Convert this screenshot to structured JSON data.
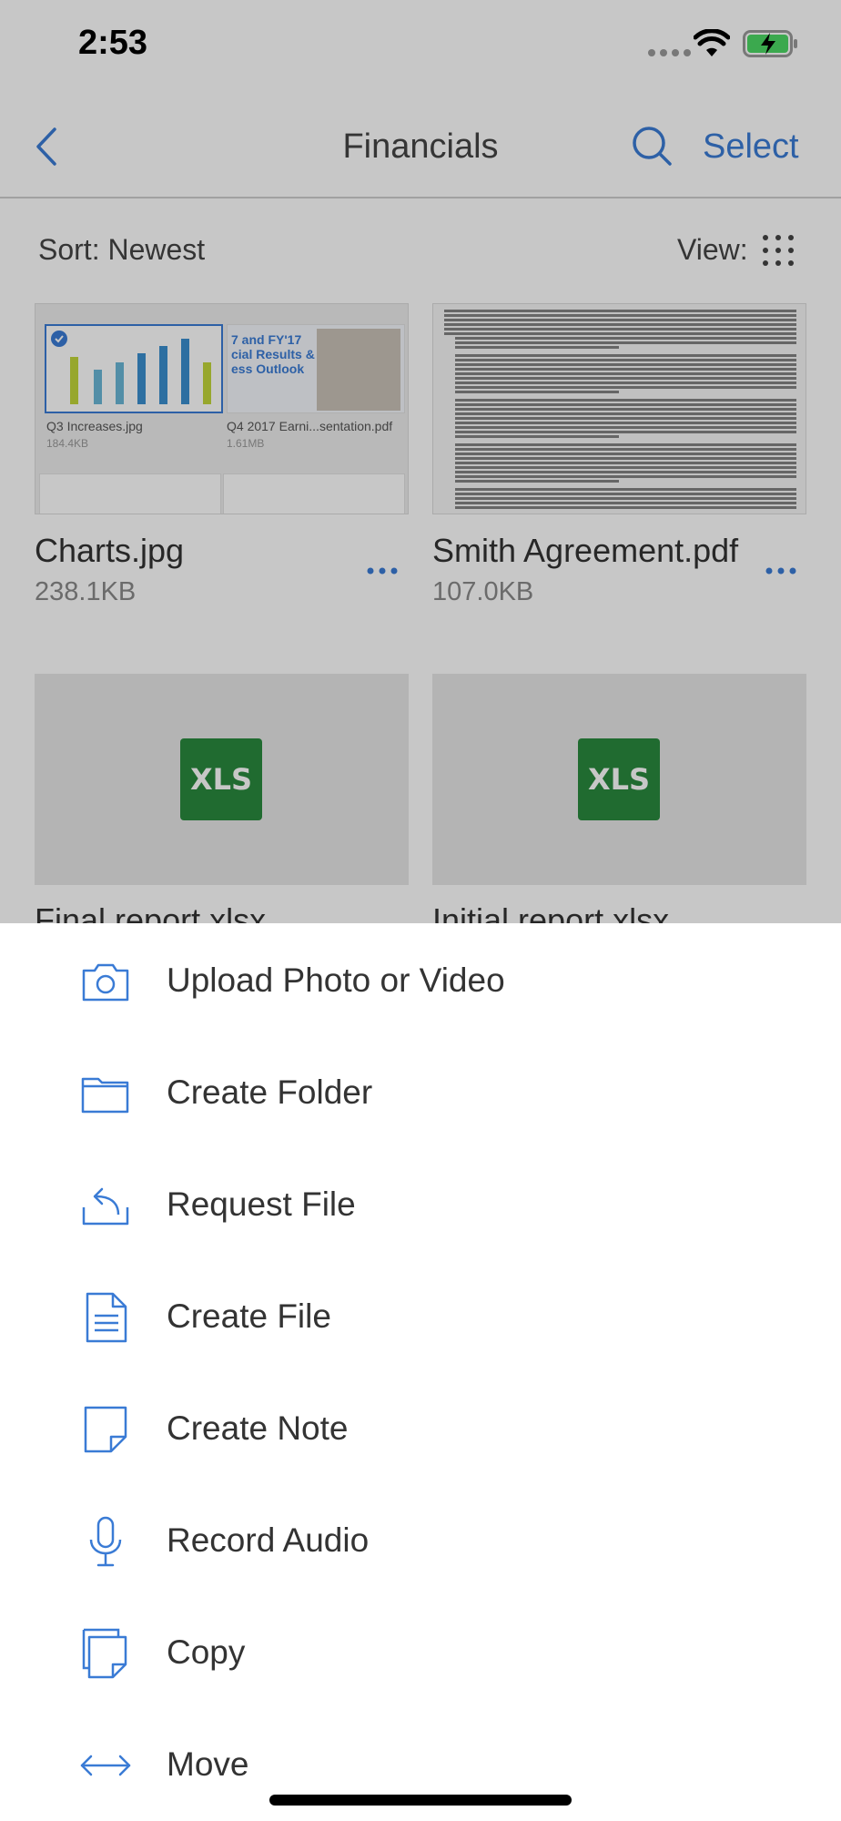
{
  "status_bar": {
    "time": "2:53"
  },
  "nav": {
    "title": "Financials",
    "select_label": "Select"
  },
  "toolbar": {
    "sort_label": "Sort: Newest",
    "view_label": "View:"
  },
  "files": [
    {
      "name": "Charts.jpg",
      "size": "238.1KB"
    },
    {
      "name": "Smith Agreement.pdf",
      "size": "107.0KB"
    },
    {
      "name": "Final report.xlsx",
      "badge": "XLS"
    },
    {
      "name": "Initial report.xlsx",
      "badge": "XLS"
    }
  ],
  "charts_thumb": {
    "card1_caption": "Q3 Increases.jpg",
    "card1_size": "184.4KB",
    "card2_caption": "Q4 2017 Earni...sentation.pdf",
    "card2_size": "1.61MB",
    "card2_text": "7 and FY'17\ncial Results &\ness Outlook"
  },
  "actions": [
    {
      "label": "Upload Photo or Video",
      "icon": "camera-icon"
    },
    {
      "label": "Create Folder",
      "icon": "folder-icon"
    },
    {
      "label": "Request File",
      "icon": "request-file-icon"
    },
    {
      "label": "Create File",
      "icon": "file-icon"
    },
    {
      "label": "Create Note",
      "icon": "note-icon"
    },
    {
      "label": "Record Audio",
      "icon": "microphone-icon"
    },
    {
      "label": "Copy",
      "icon": "copy-icon"
    },
    {
      "label": "Move",
      "icon": "move-icon"
    }
  ],
  "colors": {
    "accent": "#3a7bd5",
    "xls_green": "#2a8a3e"
  }
}
